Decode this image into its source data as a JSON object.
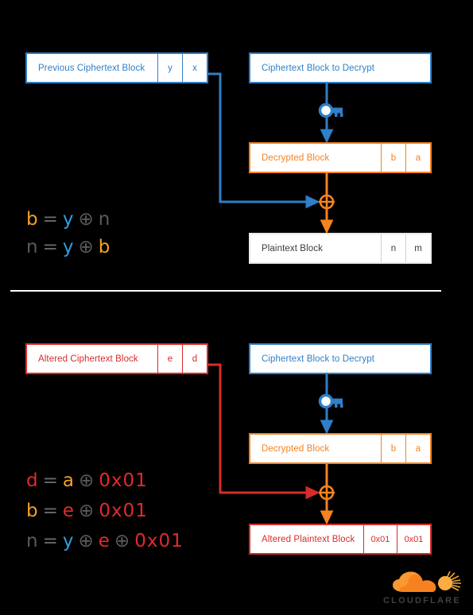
{
  "diagram": {
    "title": "CBC padding oracle / bit-flipping attack diagram",
    "colors": {
      "background": "#000000",
      "blue": "#2f7fc9",
      "orange": "#f6821f",
      "red": "#d92b2b",
      "gray_text": "#3b3b3b",
      "divider": "#ffffff",
      "logo_orange": "#f6821f"
    },
    "sections": [
      {
        "id": "normal-decryption",
        "blocks": [
          {
            "id": "previous-ciphertext-block",
            "label": "Previous Ciphertext Block",
            "theme": "blue",
            "cells": [
              "y",
              "x"
            ]
          },
          {
            "id": "ciphertext-block-to-decrypt-top",
            "label": "Ciphertext Block to Decrypt",
            "theme": "blue",
            "cells": []
          },
          {
            "id": "decrypted-block-top",
            "label": "Decrypted Block",
            "theme": "orange",
            "cells": [
              "b",
              "a"
            ]
          },
          {
            "id": "plaintext-block",
            "label": "Plaintext Block",
            "theme": "gray",
            "cells": [
              "n",
              "m"
            ]
          }
        ],
        "icons": [
          {
            "id": "key-icon-top",
            "name": "key-icon",
            "color": "#2f7fc9"
          },
          {
            "id": "xor-icon-top",
            "name": "xor-icon",
            "color": "#f6821f",
            "glyph": "⊕"
          }
        ],
        "equations": [
          {
            "id": "eq-b",
            "tokens": [
              {
                "text": "b",
                "color": "orange"
              },
              {
                "text": "=",
                "color": "eq"
              },
              {
                "text": "y",
                "color": "blue"
              },
              {
                "text": "⊕",
                "color": "gray"
              },
              {
                "text": "n",
                "color": "gray"
              }
            ]
          },
          {
            "id": "eq-n",
            "tokens": [
              {
                "text": "n",
                "color": "gray"
              },
              {
                "text": "=",
                "color": "eq"
              },
              {
                "text": "y",
                "color": "blue"
              },
              {
                "text": "⊕",
                "color": "gray"
              },
              {
                "text": "b",
                "color": "orange"
              }
            ]
          }
        ]
      },
      {
        "id": "altered-decryption",
        "blocks": [
          {
            "id": "altered-ciphertext-block",
            "label": "Altered Ciphertext Block",
            "theme": "red",
            "cells": [
              "e",
              "d"
            ]
          },
          {
            "id": "ciphertext-block-to-decrypt-bottom",
            "label": "Ciphertext Block to Decrypt",
            "theme": "blue",
            "cells": []
          },
          {
            "id": "decrypted-block-bottom",
            "label": "Decrypted Block",
            "theme": "orange",
            "cells": [
              "b",
              "a"
            ]
          },
          {
            "id": "altered-plaintext-block",
            "label": "Altered Plaintext Block",
            "theme": "red",
            "cells": [
              "0x01",
              "0x01"
            ]
          }
        ],
        "icons": [
          {
            "id": "key-icon-bottom",
            "name": "key-icon",
            "color": "#2f7fc9"
          },
          {
            "id": "xor-icon-bottom",
            "name": "xor-icon",
            "color": "#f6821f",
            "glyph": "⊕"
          }
        ],
        "equations": [
          {
            "id": "eq-d",
            "tokens": [
              {
                "text": "d",
                "color": "red"
              },
              {
                "text": "=",
                "color": "eq"
              },
              {
                "text": "a",
                "color": "orange"
              },
              {
                "text": "⊕",
                "color": "gray"
              },
              {
                "text": "0x01",
                "color": "red"
              }
            ]
          },
          {
            "id": "eq-b2",
            "tokens": [
              {
                "text": "b",
                "color": "orange"
              },
              {
                "text": "=",
                "color": "eq"
              },
              {
                "text": "e",
                "color": "red"
              },
              {
                "text": "⊕",
                "color": "gray"
              },
              {
                "text": "0x01",
                "color": "red"
              }
            ]
          },
          {
            "id": "eq-n2",
            "tokens": [
              {
                "text": "n",
                "color": "gray"
              },
              {
                "text": "=",
                "color": "eq"
              },
              {
                "text": "y",
                "color": "blue"
              },
              {
                "text": "⊕",
                "color": "gray"
              },
              {
                "text": "e",
                "color": "red"
              },
              {
                "text": "⊕",
                "color": "gray"
              },
              {
                "text": "0x01",
                "color": "red"
              }
            ]
          }
        ]
      }
    ],
    "logo": {
      "name": "cloudflare-logo",
      "wordmark": "CLOUDFLARE"
    }
  }
}
